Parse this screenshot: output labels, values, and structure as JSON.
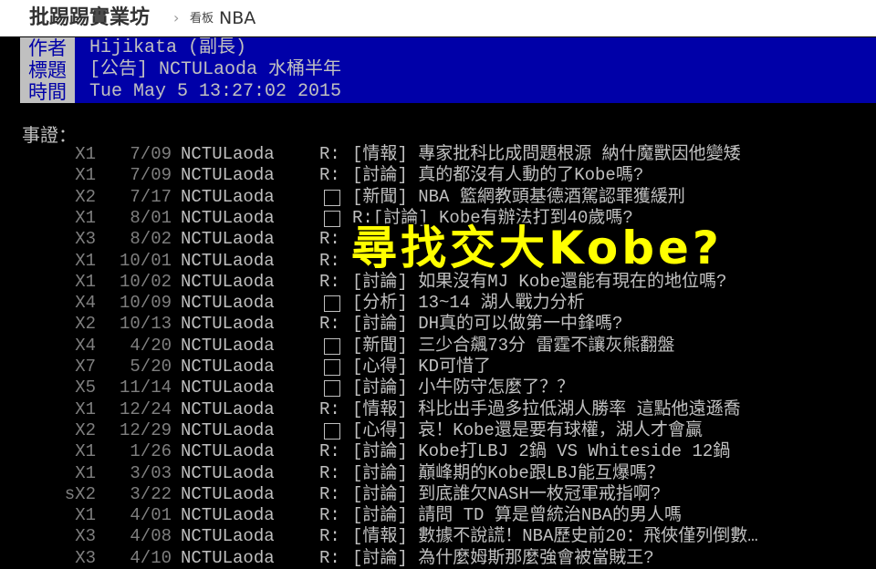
{
  "site": {
    "name": "批踢踢實業坊",
    "separator": "›",
    "board_label": "看板",
    "board": "NBA"
  },
  "header": {
    "author": {
      "key": "作者",
      "value": "Hijikata (副長)"
    },
    "title": {
      "key": "標題",
      "value": "[公告] NCTULaoda 水桶半年"
    },
    "time": {
      "key": "時間",
      "value": "Tue May  5 13:27:02 2015"
    }
  },
  "body_label": "事證：",
  "overlay_text": "尋找交大Kobe?",
  "rows": [
    {
      "mark": "X1",
      "date": "7/09",
      "author": "NCTULaoda",
      "reply": "R:",
      "title": "[情報] 專家批科比成問題根源 納什魔獸因他變矮"
    },
    {
      "mark": "X1",
      "date": "7/09",
      "author": "NCTULaoda",
      "reply": "R:",
      "title": "[討論] 真的都沒有人動的了Kobe嗎?"
    },
    {
      "mark": "X2",
      "date": "7/17",
      "author": "NCTULaoda",
      "reply": "□",
      "title": "[新聞] NBA 籃網教頭基德酒駕認罪獲緩刑"
    },
    {
      "mark": "X1",
      "date": "8/01",
      "author": "NCTULaoda",
      "reply": "□",
      "title": "R:[討論] Kobe有辦法打到40歲嗎?"
    },
    {
      "mark": "X3",
      "date": "8/02",
      "author": "NCTULaoda",
      "reply": "R:",
      "title": ""
    },
    {
      "mark": "X1",
      "date": "10/01",
      "author": "NCTULaoda",
      "reply": "R:",
      "title": ""
    },
    {
      "mark": "X1",
      "date": "10/02",
      "author": "NCTULaoda",
      "reply": "R:",
      "title": "[討論] 如果沒有MJ Kobe還能有現在的地位嗎?"
    },
    {
      "mark": "X4",
      "date": "10/09",
      "author": "NCTULaoda",
      "reply": "□",
      "title": "[分析] 13~14 湖人戰力分析"
    },
    {
      "mark": "X2",
      "date": "10/13",
      "author": "NCTULaoda",
      "reply": "R:",
      "title": "[討論] DH真的可以做第一中鋒嗎?"
    },
    {
      "mark": "X4",
      "date": "4/20",
      "author": "NCTULaoda",
      "reply": "□",
      "title": "[新聞] 三少合飆73分 雷霆不讓灰熊翻盤"
    },
    {
      "mark": "X7",
      "date": "5/20",
      "author": "NCTULaoda",
      "reply": "□",
      "title": "[心得] KD可惜了"
    },
    {
      "mark": "X5",
      "date": "11/14",
      "author": "NCTULaoda",
      "reply": "□",
      "title": "[討論] 小牛防守怎麼了？？"
    },
    {
      "mark": "X1",
      "date": "12/24",
      "author": "NCTULaoda",
      "reply": "R:",
      "title": "[情報] 科比出手過多拉低湖人勝率 這點他遠遜喬"
    },
    {
      "mark": "X2",
      "date": "12/29",
      "author": "NCTULaoda",
      "reply": "□",
      "title": "[心得] 哀！Kobe還是要有球權，湖人才會贏"
    },
    {
      "mark": "X1",
      "date": "1/26",
      "author": "NCTULaoda",
      "reply": "R:",
      "title": "[討論] Kobe打LBJ 2鍋 VS Whiteside 12鍋"
    },
    {
      "mark": "X1",
      "date": "3/03",
      "author": "NCTULaoda",
      "reply": "R:",
      "title": "[討論] 巔峰期的Kobe跟LBJ能互爆嗎？"
    },
    {
      "mark": "sX2",
      "date": "3/22",
      "author": "NCTULaoda",
      "reply": "R:",
      "title": "[討論] 到底誰欠NASH一枚冠軍戒指啊?"
    },
    {
      "mark": "X1",
      "date": "4/01",
      "author": "NCTULaoda",
      "reply": "R:",
      "title": "[討論] 請問 TD 算是曾統治NBA的男人嗎"
    },
    {
      "mark": "X3",
      "date": "4/08",
      "author": "NCTULaoda",
      "reply": "R:",
      "title": "[情報] 數據不說謊！NBA歷史前20：飛俠僅列倒數…"
    },
    {
      "mark": "X3",
      "date": "4/10",
      "author": "NCTULaoda",
      "reply": "R:",
      "title": "[討論] 為什麼姆斯那麼強會被當賊王?"
    }
  ]
}
